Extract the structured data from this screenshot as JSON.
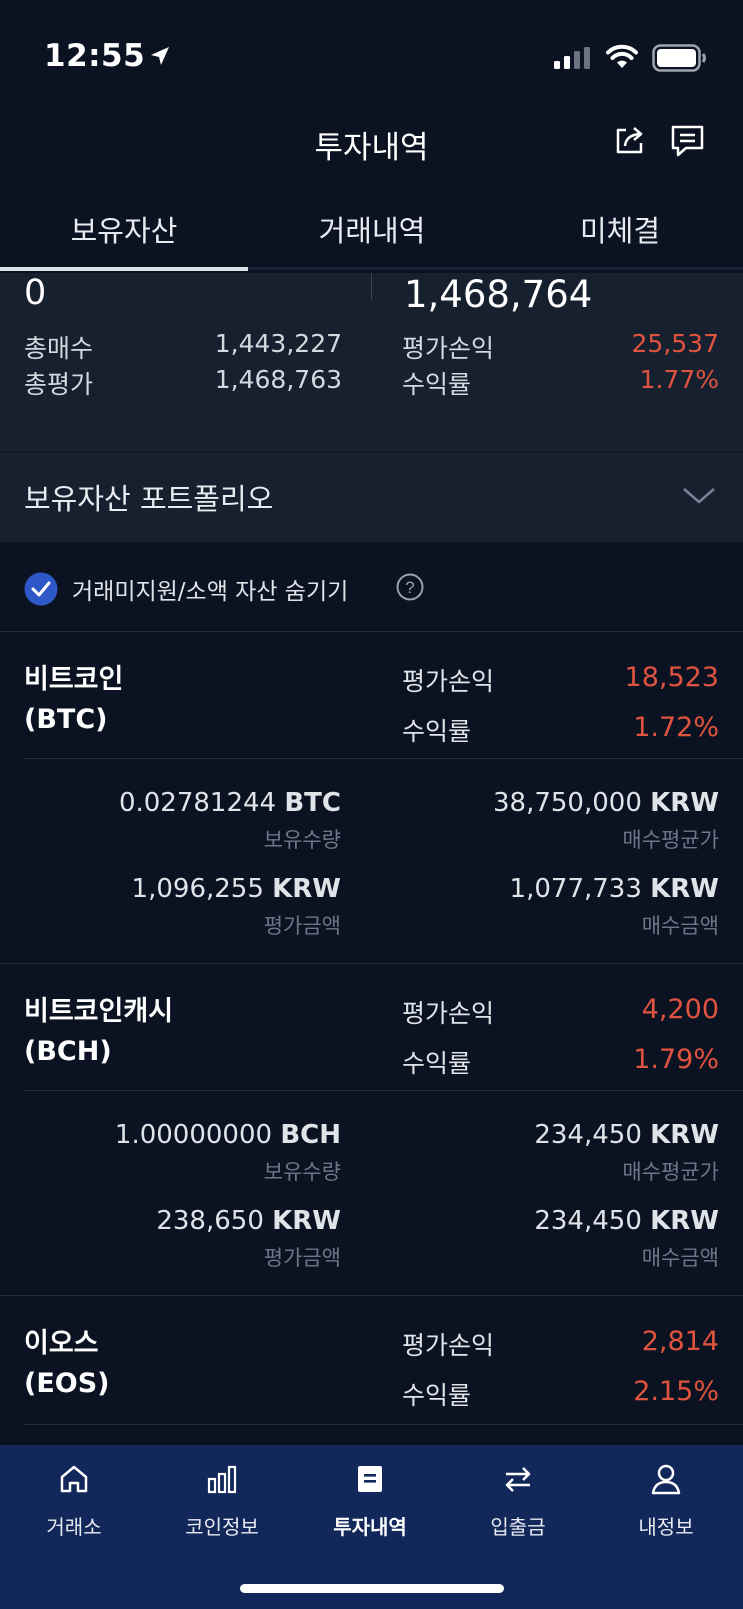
{
  "status": {
    "time": "12:55"
  },
  "header": {
    "title": "투자내역"
  },
  "tabs": [
    "보유자산",
    "거래내역",
    "미체결"
  ],
  "summary": {
    "top_left": "0",
    "top_right": "1,468,764",
    "total_buy_label": "총매수",
    "total_buy": "1,443,227",
    "total_eval_label": "총평가",
    "total_eval": "1,468,763",
    "pnl_label": "평가손익",
    "pnl": "25,537",
    "roi_label": "수익률",
    "roi": "1.77%"
  },
  "portfolio": {
    "label": "보유자산 포트폴리오"
  },
  "hide_small": {
    "label": "거래미지원/소액 자산 숨기기",
    "checked": true
  },
  "labels": {
    "pnl": "평가손익",
    "roi": "수익률",
    "holding": "보유수량",
    "avg_price": "매수평균가",
    "eval_amount": "평가금액",
    "buy_amount": "매수금액",
    "krw": "KRW"
  },
  "coins": [
    {
      "name": "비트코인",
      "ticker": "(BTC)",
      "pnl": "18,523",
      "roi": "1.72%",
      "qty": "0.02781244",
      "qty_unit": "BTC",
      "avg_price": "38,750,000",
      "eval": "1,096,255",
      "buy": "1,077,733"
    },
    {
      "name": "비트코인캐시",
      "ticker": "(BCH)",
      "pnl": "4,200",
      "roi": "1.79%",
      "qty": "1.00000000",
      "qty_unit": "BCH",
      "avg_price": "234,450",
      "eval": "238,650",
      "buy": "234,450"
    },
    {
      "name": "이오스",
      "ticker": "(EOS)",
      "pnl": "2,814",
      "roi": "2.15%"
    }
  ],
  "nav": [
    {
      "label": "거래소",
      "icon": "home-icon"
    },
    {
      "label": "코인정보",
      "icon": "bar-chart-icon"
    },
    {
      "label": "투자내역",
      "icon": "document-icon",
      "active": true
    },
    {
      "label": "입출금",
      "icon": "transfer-icon"
    },
    {
      "label": "내정보",
      "icon": "person-icon"
    }
  ],
  "colors": {
    "background": "#0b1322",
    "panel": "#16202f",
    "profit": "#e0533f",
    "nav_bg": "#12275a",
    "check": "#2e58c8"
  }
}
